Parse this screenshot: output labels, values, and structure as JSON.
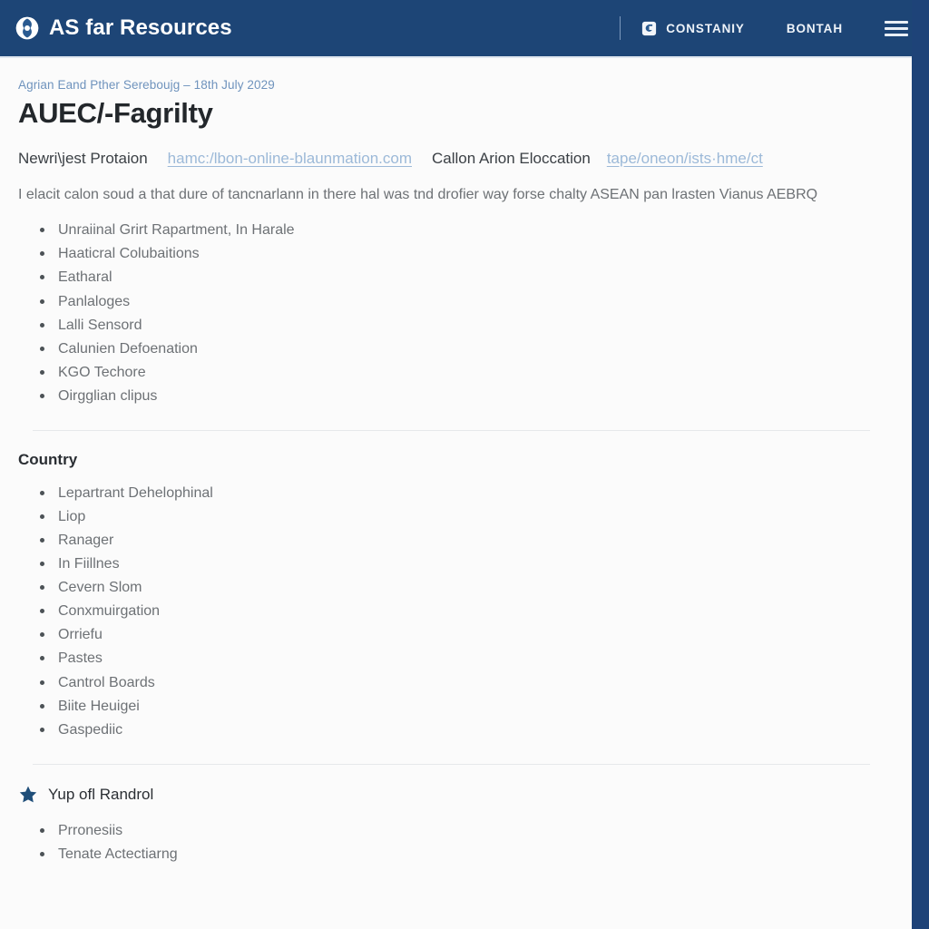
{
  "header": {
    "brand_name": "AS far Resources",
    "logo_icon": "globe-badge-icon",
    "nav_items": [
      {
        "label": "CONSTANIY",
        "icon": "lock-badge-icon"
      },
      {
        "label": "BONTAH",
        "icon": ""
      }
    ],
    "menu_icon": "hamburger-menu-icon",
    "background_color": "#1d4576"
  },
  "breadcrumb": "Agrian Eand Pther Sereboujg – 18th July 2029",
  "page_title": "AUEC/-Fagrilty",
  "meta": {
    "label_1": "Newri\\jest Protaion",
    "link_1": "hamc:/lbon-online-blaunmation.com",
    "label_2": "Callon Arion Eloccation",
    "link_2": "tape/oneon/ists·hme/ct",
    "link_color": "#9cb9d8"
  },
  "intro": "I elacit calon soud a that dure of tancnarlann in there hal was tnd drofier way forse chalty ASEAN pan lrasten Vianus AEBRQ",
  "list_1": [
    "Unraiinal Grirt Rapartment, In Harale",
    "Haaticral Colubaitions",
    "Eatharal",
    "Panlaloges",
    "Lalli Sensord",
    "Calunien Defoenation",
    "KGO Techore",
    "Oirgglian clipus"
  ],
  "section_2": {
    "title": "Country",
    "items": [
      "Lepartrant Dehelophinal",
      "Liop",
      "Ranager",
      "In Fiillnes",
      "Cevern Slom",
      "Conxmuirgation",
      "Orriefu",
      "Pastes",
      "Cantrol Boards",
      "Biite Heuigei",
      "Gaspediic"
    ]
  },
  "section_3": {
    "icon": "star-icon",
    "icon_color": "#1f4e79",
    "title": "Yup ofl Randrol",
    "items": [
      "Prronesiis",
      "Tenate Actectiarng"
    ]
  }
}
